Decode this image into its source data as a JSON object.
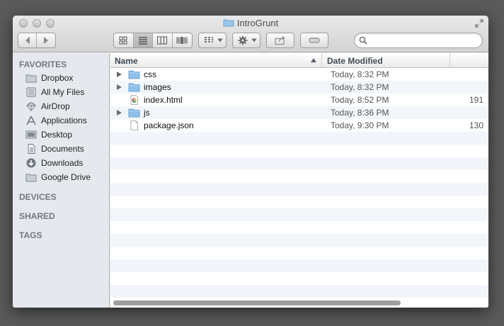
{
  "window": {
    "title": "IntroGrunt"
  },
  "search": {
    "value": "",
    "placeholder": ""
  },
  "toolbar": {
    "back_icon": "chevron-left-icon",
    "forward_icon": "chevron-right-icon",
    "view_modes": [
      "icon-view",
      "list-view",
      "column-view",
      "cover-flow-view"
    ],
    "active_view": "list-view"
  },
  "sidebar": {
    "favorites_label": "FAVORITES",
    "items": [
      {
        "label": "Dropbox",
        "icon": "folder-icon"
      },
      {
        "label": "All My Files",
        "icon": "all-files-icon"
      },
      {
        "label": "AirDrop",
        "icon": "airdrop-icon"
      },
      {
        "label": "Applications",
        "icon": "applications-icon"
      },
      {
        "label": "Desktop",
        "icon": "desktop-icon"
      },
      {
        "label": "Documents",
        "icon": "documents-icon"
      },
      {
        "label": "Downloads",
        "icon": "downloads-icon"
      },
      {
        "label": "Google Drive",
        "icon": "folder-icon"
      }
    ],
    "devices_label": "DEVICES",
    "shared_label": "SHARED",
    "tags_label": "TAGS"
  },
  "columns": {
    "name": "Name",
    "date": "Date Modified"
  },
  "files": [
    {
      "name": "css",
      "date": "Today, 8:32 PM",
      "size": "",
      "kind": "folder"
    },
    {
      "name": "images",
      "date": "Today, 8:32 PM",
      "size": "",
      "kind": "folder"
    },
    {
      "name": "index.html",
      "date": "Today, 8:52 PM",
      "size": "191",
      "kind": "html"
    },
    {
      "name": "js",
      "date": "Today, 8:36 PM",
      "size": "",
      "kind": "folder"
    },
    {
      "name": "package.json",
      "date": "Today, 9:30 PM",
      "size": "130",
      "kind": "document"
    }
  ],
  "colors": {
    "sidebar_bg": "#e5e9ee",
    "row_alt": "#f2f5fa",
    "folder_blue": "#8fc0e8"
  }
}
